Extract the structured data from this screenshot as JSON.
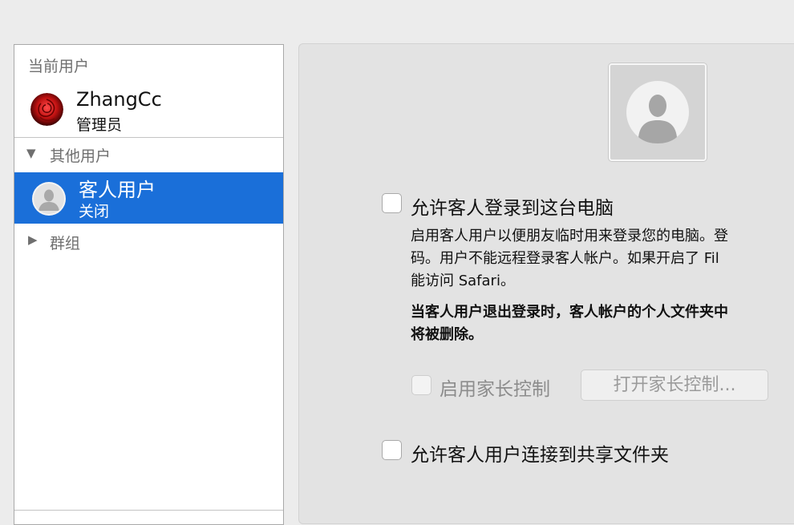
{
  "sidebar": {
    "current_user_header": "当前用户",
    "current_user": {
      "name": "ZhangCc",
      "role": "管理员"
    },
    "other_users_header": "其他用户",
    "other_users_disclosure": "▼",
    "guest_user": {
      "name": "客人用户",
      "role": "关闭"
    },
    "groups_header": "群组",
    "groups_disclosure": "▶"
  },
  "panel": {
    "allow_guest_login_label": "允许客人登录到这台电脑",
    "description_lines": [
      "启用客人用户以便朋友临时用来登录您的电脑。登",
      "码。用户不能远程登录客人帐户。如果开启了 Fil",
      "能访问 Safari。"
    ],
    "warning_lines": [
      "当客人用户退出登录时，客人帐户的个人文件夹中",
      "将被删除。"
    ],
    "parental_controls_label": "启用家长控制",
    "open_parental_controls_button": "打开家长控制...",
    "allow_shared_folders_label": "允许客人用户连接到共享文件夹"
  },
  "colors": {
    "selection": "#1a6fd9",
    "window_bg": "#ececec",
    "panel_bg": "#e3e3e3"
  },
  "icons": {
    "current_user_avatar": "red-rose-avatar",
    "guest_avatar": "silhouette-avatar",
    "guest_picture": "silhouette-avatar"
  }
}
